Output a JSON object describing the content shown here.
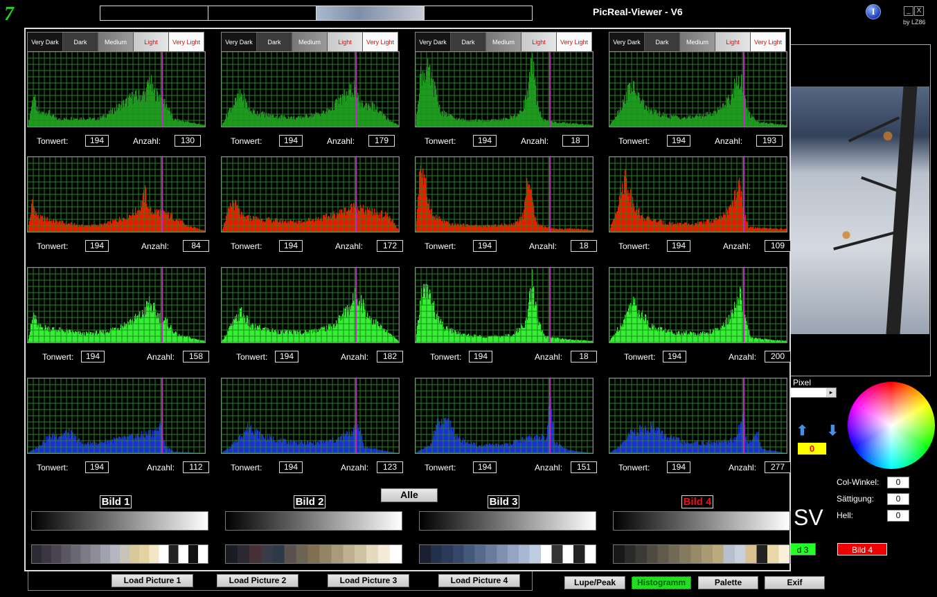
{
  "app": {
    "title": "PicReal-Viewer - V6",
    "byline": "by LZ86",
    "logo_char": "7",
    "info_glyph": "I",
    "minimize_glyph": "_",
    "close_glyph": "X"
  },
  "zones": [
    "Very Dark",
    "Dark",
    "Medium",
    "Light",
    "Very Light"
  ],
  "labels": {
    "tonwert": "Tonwert:",
    "anzahl": "Anzahl:"
  },
  "colors": {
    "row_colors": [
      "#1e9a1e",
      "#ee1a00",
      "#33ee33",
      "#1f2fd8"
    ],
    "marker": "#cc22cc",
    "grid": "#1f8a1f",
    "selected_bild": "#ee1111"
  },
  "histograms": [
    {
      "bild_label": "Bild 1",
      "rows": [
        {
          "channel": "luminance",
          "tonwert": "194",
          "anzahl": "130",
          "profile": [
            [
              0,
              2
            ],
            [
              8,
              45
            ],
            [
              14,
              18
            ],
            [
              28,
              20
            ],
            [
              42,
              10
            ],
            [
              70,
              12
            ],
            [
              100,
              10
            ],
            [
              120,
              20
            ],
            [
              150,
              40
            ],
            [
              170,
              45
            ],
            [
              176,
              68
            ],
            [
              180,
              48
            ],
            [
              190,
              42
            ],
            [
              200,
              30
            ],
            [
              210,
              10
            ],
            [
              255,
              2
            ]
          ]
        },
        {
          "channel": "red",
          "tonwert": "194",
          "anzahl": "84",
          "profile": [
            [
              0,
              2
            ],
            [
              6,
              40
            ],
            [
              14,
              20
            ],
            [
              40,
              14
            ],
            [
              80,
              8
            ],
            [
              110,
              10
            ],
            [
              140,
              20
            ],
            [
              160,
              30
            ],
            [
              170,
              55
            ],
            [
              174,
              28
            ],
            [
              190,
              28
            ],
            [
              210,
              20
            ],
            [
              230,
              8
            ],
            [
              255,
              2
            ]
          ]
        },
        {
          "channel": "green",
          "tonwert": "194",
          "anzahl": "158",
          "profile": [
            [
              0,
              2
            ],
            [
              8,
              40
            ],
            [
              14,
              22
            ],
            [
              40,
              18
            ],
            [
              80,
              12
            ],
            [
              110,
              14
            ],
            [
              140,
              25
            ],
            [
              165,
              38
            ],
            [
              175,
              55
            ],
            [
              185,
              40
            ],
            [
              200,
              28
            ],
            [
              215,
              10
            ],
            [
              255,
              2
            ]
          ]
        },
        {
          "channel": "blue",
          "tonwert": "194",
          "anzahl": "112",
          "profile": [
            [
              0,
              1
            ],
            [
              10,
              6
            ],
            [
              30,
              22
            ],
            [
              60,
              28
            ],
            [
              80,
              12
            ],
            [
              110,
              16
            ],
            [
              150,
              22
            ],
            [
              180,
              28
            ],
            [
              192,
              36
            ],
            [
              198,
              10
            ],
            [
              210,
              2
            ],
            [
              255,
              0
            ]
          ]
        }
      ]
    },
    {
      "bild_label": "Bild 2",
      "rows": [
        {
          "channel": "luminance",
          "tonwert": "194",
          "anzahl": "179",
          "profile": [
            [
              0,
              2
            ],
            [
              10,
              22
            ],
            [
              28,
              45
            ],
            [
              40,
              22
            ],
            [
              70,
              15
            ],
            [
              110,
              12
            ],
            [
              150,
              20
            ],
            [
              175,
              40
            ],
            [
              192,
              55
            ],
            [
              198,
              30
            ],
            [
              215,
              30
            ],
            [
              240,
              10
            ],
            [
              255,
              2
            ]
          ]
        },
        {
          "channel": "red",
          "tonwert": "194",
          "anzahl": "172",
          "profile": [
            [
              0,
              2
            ],
            [
              6,
              20
            ],
            [
              16,
              42
            ],
            [
              30,
              20
            ],
            [
              70,
              16
            ],
            [
              110,
              14
            ],
            [
              150,
              20
            ],
            [
              175,
              28
            ],
            [
              192,
              35
            ],
            [
              210,
              28
            ],
            [
              240,
              22
            ],
            [
              255,
              2
            ]
          ]
        },
        {
          "channel": "green",
          "tonwert": "194",
          "anzahl": "182",
          "profile": [
            [
              0,
              2
            ],
            [
              10,
              18
            ],
            [
              28,
              42
            ],
            [
              42,
              22
            ],
            [
              80,
              15
            ],
            [
              120,
              14
            ],
            [
              160,
              22
            ],
            [
              185,
              50
            ],
            [
              196,
              68
            ],
            [
              210,
              38
            ],
            [
              230,
              20
            ],
            [
              255,
              2
            ]
          ]
        },
        {
          "channel": "blue",
          "tonwert": "194",
          "anzahl": "123",
          "profile": [
            [
              0,
              1
            ],
            [
              12,
              8
            ],
            [
              40,
              38
            ],
            [
              56,
              24
            ],
            [
              90,
              16
            ],
            [
              130,
              14
            ],
            [
              165,
              18
            ],
            [
              192,
              32
            ],
            [
              198,
              40
            ],
            [
              205,
              8
            ],
            [
              255,
              0
            ]
          ]
        }
      ]
    },
    {
      "bild_label": "Bild 3",
      "rows": [
        {
          "channel": "luminance",
          "tonwert": "194",
          "anzahl": "18",
          "profile": [
            [
              0,
              2
            ],
            [
              6,
              70
            ],
            [
              16,
              78
            ],
            [
              26,
              55
            ],
            [
              36,
              20
            ],
            [
              60,
              10
            ],
            [
              100,
              8
            ],
            [
              130,
              10
            ],
            [
              150,
              18
            ],
            [
              160,
              40
            ],
            [
              168,
              90
            ],
            [
              174,
              40
            ],
            [
              182,
              10
            ],
            [
              200,
              6
            ],
            [
              230,
              4
            ],
            [
              255,
              2
            ]
          ]
        },
        {
          "channel": "red",
          "tonwert": "194",
          "anzahl": "18",
          "profile": [
            [
              0,
              2
            ],
            [
              6,
              95
            ],
            [
              14,
              60
            ],
            [
              24,
              22
            ],
            [
              50,
              10
            ],
            [
              100,
              8
            ],
            [
              140,
              10
            ],
            [
              155,
              22
            ],
            [
              162,
              80
            ],
            [
              168,
              40
            ],
            [
              176,
              10
            ],
            [
              200,
              4
            ],
            [
              230,
              4
            ],
            [
              255,
              2
            ]
          ]
        },
        {
          "channel": "green",
          "tonwert": "194",
          "anzahl": "18",
          "profile": [
            [
              0,
              2
            ],
            [
              8,
              68
            ],
            [
              18,
              72
            ],
            [
              28,
              40
            ],
            [
              40,
              20
            ],
            [
              70,
              10
            ],
            [
              110,
              8
            ],
            [
              140,
              10
            ],
            [
              160,
              30
            ],
            [
              168,
              85
            ],
            [
              176,
              30
            ],
            [
              186,
              8
            ],
            [
              220,
              4
            ],
            [
              255,
              2
            ]
          ]
        },
        {
          "channel": "blue",
          "tonwert": "194",
          "anzahl": "151",
          "profile": [
            [
              0,
              1
            ],
            [
              20,
              10
            ],
            [
              30,
              40
            ],
            [
              50,
              40
            ],
            [
              60,
              20
            ],
            [
              90,
              10
            ],
            [
              130,
              12
            ],
            [
              160,
              20
            ],
            [
              188,
              22
            ],
            [
              194,
              75
            ],
            [
              200,
              15
            ],
            [
              220,
              4
            ],
            [
              255,
              0
            ]
          ]
        }
      ]
    },
    {
      "bild_label": "Bild 4",
      "rows": [
        {
          "channel": "luminance",
          "tonwert": "194",
          "anzahl": "193",
          "profile": [
            [
              0,
              2
            ],
            [
              18,
              30
            ],
            [
              30,
              58
            ],
            [
              42,
              40
            ],
            [
              56,
              22
            ],
            [
              80,
              15
            ],
            [
              110,
              12
            ],
            [
              150,
              18
            ],
            [
              175,
              40
            ],
            [
              185,
              70
            ],
            [
              192,
              55
            ],
            [
              198,
              20
            ],
            [
              215,
              6
            ],
            [
              255,
              2
            ]
          ]
        },
        {
          "channel": "red",
          "tonwert": "194",
          "anzahl": "109",
          "profile": [
            [
              0,
              2
            ],
            [
              12,
              40
            ],
            [
              22,
              75
            ],
            [
              32,
              45
            ],
            [
              46,
              20
            ],
            [
              80,
              12
            ],
            [
              120,
              10
            ],
            [
              160,
              18
            ],
            [
              176,
              35
            ],
            [
              186,
              65
            ],
            [
              194,
              30
            ],
            [
              200,
              6
            ],
            [
              240,
              4
            ],
            [
              255,
              4
            ]
          ]
        },
        {
          "channel": "green",
          "tonwert": "194",
          "anzahl": "200",
          "profile": [
            [
              0,
              2
            ],
            [
              20,
              30
            ],
            [
              32,
              56
            ],
            [
              46,
              40
            ],
            [
              60,
              22
            ],
            [
              90,
              14
            ],
            [
              130,
              12
            ],
            [
              160,
              18
            ],
            [
              178,
              40
            ],
            [
              188,
              68
            ],
            [
              196,
              30
            ],
            [
              204,
              6
            ],
            [
              255,
              2
            ]
          ]
        },
        {
          "channel": "blue",
          "tonwert": "194",
          "anzahl": "277",
          "profile": [
            [
              0,
              1
            ],
            [
              16,
              10
            ],
            [
              30,
              28
            ],
            [
              64,
              38
            ],
            [
              78,
              24
            ],
            [
              110,
              14
            ],
            [
              150,
              14
            ],
            [
              180,
              18
            ],
            [
              192,
              45
            ],
            [
              200,
              12
            ],
            [
              212,
              30
            ],
            [
              220,
              6
            ],
            [
              255,
              0
            ]
          ]
        }
      ]
    }
  ],
  "marker_tonwert": 194,
  "alle_label": "Alle",
  "palette_strips": [
    [
      "#2a2a30",
      "#3a3540",
      "#4a4450",
      "#5a5662",
      "#6a6872",
      "#7c7a86",
      "#8e8c96",
      "#a0a2ae",
      "#b4b6c2",
      "#c8c4b8",
      "#d8c89a",
      "#e4d2a0",
      "#f2e8c8",
      "#ffffff",
      "#222",
      "#fff",
      "#111",
      "#fff"
    ],
    [
      "#1a1c24",
      "#2c2830",
      "#453038",
      "#3a3a48",
      "#2c3a48",
      "#5a5050",
      "#6a6450",
      "#807050",
      "#948466",
      "#a89a7a",
      "#bcb090",
      "#cec4a4",
      "#e4dac0",
      "#f4ecd8",
      "#ffffff"
    ],
    [
      "#1a2030",
      "#22304a",
      "#2a3a58",
      "#34466a",
      "#44587a",
      "#566a8c",
      "#6a7c9c",
      "#8090b0",
      "#94a4c2",
      "#a8b8d2",
      "#c0cce0",
      "#ffffff",
      "#333",
      "#fff",
      "#222",
      "#fff"
    ],
    [
      "#181818",
      "#2a2a28",
      "#3c3a34",
      "#4e4a40",
      "#605a4a",
      "#726a54",
      "#847a5e",
      "#968a68",
      "#a89a72",
      "#baaa7c",
      "#b8c0d0",
      "#c8d0dc",
      "#d8c090",
      "#222",
      "#e8d8a8",
      "#f8f0d8"
    ]
  ],
  "load_buttons": [
    "Load Picture 1",
    "Load Picture 2",
    "Load Picture 3",
    "Load Picture 4"
  ],
  "view_buttons": [
    "Lupe/Peak",
    "Histogramm",
    "Palette",
    "Exif"
  ],
  "right_panel": {
    "pixel_label": "Pixel",
    "slider_arrow": "▸",
    "value_display": "0",
    "col_winkel_label": "Col-Winkel:",
    "col_winkel_value": "0",
    "saettigung_label": "Sättigung:",
    "saettigung_value": "0",
    "hell_label": "Hell:",
    "hell_value": "0",
    "big_text": "SV",
    "badge_green": "d 3",
    "badge_red": "Bild 4"
  }
}
